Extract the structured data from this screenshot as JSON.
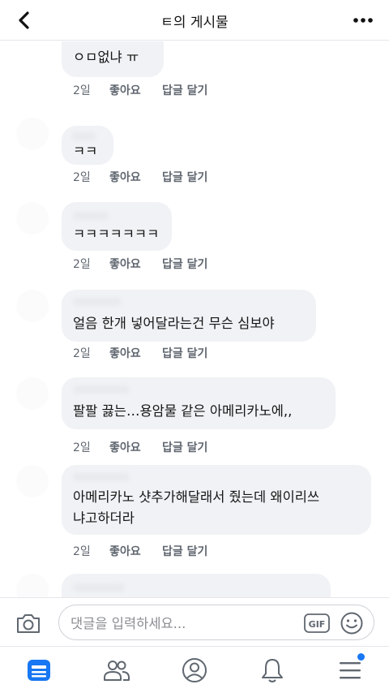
{
  "header": {
    "title": "ㅌ의 게시물"
  },
  "comments": [
    {
      "text_lines": [
        "ㅇㅁ없냐 ㅠ"
      ],
      "time": "2일",
      "like": "좋아요",
      "reply": "답글 달기"
    },
    {
      "text_lines": [
        "ㅋㅋ"
      ],
      "time": "2일",
      "like": "좋아요",
      "reply": "답글 달기"
    },
    {
      "text_lines": [
        "ㅋㅋㅋㅋㅋㅋㅋ"
      ],
      "time": "2일",
      "like": "좋아요",
      "reply": "답글 달기"
    },
    {
      "text_lines": [
        "얼음 한개 넣어달라는건 무슨 심보야"
      ],
      "time": "2일",
      "like": "좋아요",
      "reply": "답글 달기"
    },
    {
      "text_lines": [
        "팔팔 끓는…용암물 같은 아메리카노에,,"
      ],
      "time": "2일",
      "like": "좋아요",
      "reply": "답글 달기"
    },
    {
      "text_lines": [
        "아메리카노 샷추가해달래서 줬는데 왜이리쓰",
        "냐고하더라"
      ],
      "time": "2일",
      "like": "좋아요",
      "reply": "답글 달기"
    }
  ],
  "composer": {
    "placeholder": "댓글을 입력하세요...",
    "gif_label": "GIF",
    "camera_icon": "camera-icon",
    "emoji_icon": "emoji-icon"
  },
  "tabbar": {
    "items": [
      "news-feed-icon",
      "friends-icon",
      "profile-icon",
      "notifications-icon",
      "menu-icon"
    ],
    "active": "news-feed-icon",
    "accent": "#1877f2"
  }
}
